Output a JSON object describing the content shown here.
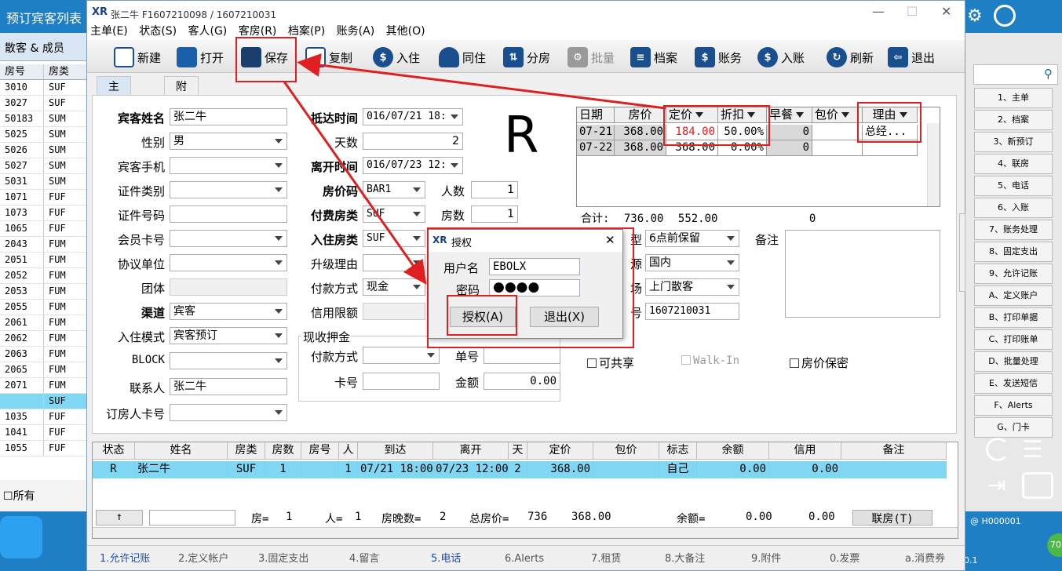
{
  "background": {
    "title": "预订宾客列表",
    "left_tab": "散客 & 成员",
    "left_table": {
      "headers": [
        "房号",
        "房类"
      ],
      "rows": [
        [
          "3010",
          "SUF"
        ],
        [
          "3027",
          "SUF"
        ],
        [
          "50183",
          "SUM"
        ],
        [
          "5025",
          "SUM"
        ],
        [
          "5026",
          "SUM"
        ],
        [
          "5027",
          "SUM"
        ],
        [
          "5031",
          "SUM"
        ],
        [
          "1071",
          "FUF"
        ],
        [
          "1073",
          "FUF"
        ],
        [
          "1065",
          "FUF"
        ],
        [
          "2043",
          "FUM"
        ],
        [
          "2051",
          "FUM"
        ],
        [
          "2052",
          "FUM"
        ],
        [
          "2053",
          "FUM"
        ],
        [
          "2055",
          "FUM"
        ],
        [
          "2061",
          "FUM"
        ],
        [
          "2062",
          "FUM"
        ],
        [
          "2063",
          "FUM"
        ],
        [
          "2065",
          "FUM"
        ],
        [
          "2071",
          "FUM"
        ],
        [
          "",
          "SUF"
        ],
        [
          "1035",
          "FUF"
        ],
        [
          "1041",
          "FUF"
        ],
        [
          "1055",
          "FUF"
        ]
      ],
      "selected_row": 20
    },
    "left_bottom_check": "所有",
    "right_buttons": [
      "1、主单",
      "2、档案",
      "3、新预订",
      "4、联房",
      "5、电话",
      "6、入账",
      "7、账务处理",
      "8、固定支出",
      "9、允许记账",
      "A、定义账户",
      "B、打印单据",
      "C、打印账单",
      "D、批量处理",
      "E、发送短信",
      "F、Alerts",
      "G、门卡"
    ],
    "right_status": "@ H000001",
    "right_status2": "0.1",
    "badge": "70"
  },
  "window": {
    "title": "张二牛  F1607210098 / 1607210031",
    "menu": [
      "主单(E)",
      "状态(S)",
      "客人(G)",
      "客房(R)",
      "档案(P)",
      "账务(A)",
      "其他(O)"
    ],
    "toolbar": [
      "新建",
      "打开",
      "保存",
      "复制",
      "入住",
      "同住",
      "分房",
      "批量",
      "档案",
      "账务",
      "入账",
      "刷新",
      "退出"
    ],
    "tabs": [
      "主要信息",
      "附加信息"
    ]
  },
  "form": {
    "guest_name_label": "宾客姓名",
    "guest_name": "张二牛",
    "gender_label": "性别",
    "gender": "男",
    "mobile_label": "宾客手机",
    "mobile": "",
    "id_type_label": "证件类别",
    "id_type": "",
    "id_no_label": "证件号码",
    "id_no": "",
    "member_label": "会员卡号",
    "member": "",
    "agreement_label": "协议单位",
    "agreement": "",
    "group_label": "团体",
    "group": "",
    "channel_label": "渠道",
    "channel": "宾客",
    "checkin_mode_label": "入住模式",
    "checkin_mode": "宾客预订",
    "block_label": "BLOCK",
    "block": "",
    "contact_label": "联系人",
    "contact": "张二牛",
    "booker_card_label": "订房人卡号",
    "booker_card": "",
    "arrival_label": "抵达时间",
    "arrival": "016/07/21 18:",
    "days_label": "天数",
    "days": "2",
    "departure_label": "离开时间",
    "departure": "016/07/23 12:",
    "rate_code_label": "房价码",
    "rate_code": "BAR1",
    "persons_label": "人数",
    "persons": "1",
    "paid_room_type_label": "付费房类",
    "paid_room_type": "SUF",
    "rooms_label": "房数",
    "rooms": "1",
    "checkin_room_type_label": "入住房类",
    "checkin_room_type": "SUF",
    "upgrade_label": "升级理由",
    "upgrade": "",
    "payment_label": "付款方式",
    "payment": "现金",
    "credit_label": "信用限额",
    "credit": "",
    "deposit_group_label": "现收押金",
    "dep_payment_label": "付款方式",
    "dep_payment": "",
    "dep_no_label": "单号",
    "dep_no": "",
    "dep_card_label": "卡号",
    "dep_card": "",
    "dep_amount_label": "金额",
    "dep_amount": "0.00",
    "big_letter": "R",
    "reserve_type_label": "型",
    "reserve_type": "6点前保留",
    "source_label": "源",
    "source": "国内",
    "market_label": "场",
    "market": "上门散客",
    "res_no_label": "号",
    "res_no": "1607210031",
    "remarks_label": "备注",
    "share_label": "可共享",
    "walkin_label": "Walk-In",
    "rate_secret_label": "房价保密"
  },
  "rate_grid": {
    "headers": [
      "日期",
      "房价",
      "定价",
      "折扣",
      "早餐",
      "包价",
      "理由"
    ],
    "rows": [
      [
        "07-21",
        "368.00",
        "184.00",
        "50.00%",
        "0",
        "",
        "总经..."
      ],
      [
        "07-22",
        "368.00",
        "368.00",
        "0.00%",
        "0",
        "",
        ""
      ]
    ],
    "totals_label": "合计:",
    "total_room": "736.00",
    "total_rate": "552.00",
    "total_bf": "0"
  },
  "dialog": {
    "title": "授权",
    "user_label": "用户名",
    "user": "EBOLX",
    "pwd_label": "密码",
    "pwd": "●●●●",
    "ok": "授权(A)",
    "cancel": "退出(X)"
  },
  "bottom_grid": {
    "headers": [
      "状态",
      "姓名",
      "房类",
      "房数",
      "房号",
      "人",
      "到达",
      "离开",
      "天",
      "定价",
      "包价",
      "标志",
      "余额",
      "信用",
      "备注"
    ],
    "row": [
      "R",
      "张二牛",
      "SUF",
      "1",
      "",
      "1",
      "07/21 18:00",
      "07/23 12:00",
      "2",
      "368.00",
      "",
      "自己",
      "0.00",
      "0.00",
      ""
    ],
    "summary": {
      "up": "↑",
      "rooms_label": "房=",
      "rooms": "1",
      "persons_label": "人=",
      "persons": "1",
      "nights_label": "房晚数=",
      "nights": "2",
      "total_label": "总房价=",
      "total": "736",
      "total2": "368.00",
      "balance_label": "余额=",
      "balance": "0.00",
      "balance2": "0.00",
      "link_button": "联房(T)"
    }
  },
  "footer_tabs": [
    "1.允许记账",
    "2.定义帐户",
    "3.固定支出",
    "4.留言",
    "5.电话",
    "6.Alerts",
    "7.租赁",
    "8.大备注",
    "9.附件",
    "0.发票",
    "a.消费券"
  ],
  "colors": {
    "accent": "#1f7fc4",
    "highlight": "#e02020",
    "selected_row": "#7fd7f3"
  }
}
